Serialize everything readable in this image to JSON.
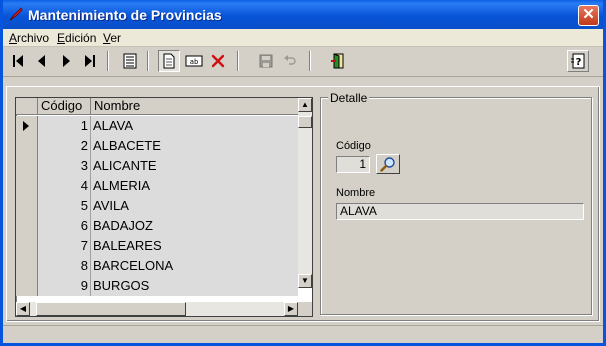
{
  "window": {
    "title": "Mantenimiento de Provincias",
    "icons": {
      "app": "quill-pen-icon",
      "close": "close-icon"
    },
    "colors": {
      "titlebar": "#0a54d8",
      "close": "#c2381a"
    }
  },
  "menu": {
    "items": [
      {
        "label": "Archivo",
        "accesskey": "A"
      },
      {
        "label": "Edición",
        "accesskey": "E"
      },
      {
        "label": "Ver",
        "accesskey": "V"
      }
    ]
  },
  "toolbar": {
    "buttons": [
      {
        "icon": "first-record-icon"
      },
      {
        "icon": "previous-record-icon"
      },
      {
        "icon": "next-record-icon"
      },
      {
        "icon": "last-record-icon"
      },
      {
        "icon": "list-view-icon"
      },
      {
        "icon": "new-record-icon"
      },
      {
        "icon": "edit-record-icon"
      },
      {
        "icon": "delete-icon"
      },
      {
        "icon": "save-icon"
      },
      {
        "icon": "undo-icon"
      },
      {
        "icon": "exit-door-icon"
      },
      {
        "icon": "help-icon"
      }
    ]
  },
  "grid": {
    "columns": [
      "Código",
      "Nombre"
    ],
    "rows": [
      {
        "codigo": "1",
        "nombre": "ALAVA"
      },
      {
        "codigo": "2",
        "nombre": "ALBACETE"
      },
      {
        "codigo": "3",
        "nombre": "ALICANTE"
      },
      {
        "codigo": "4",
        "nombre": "ALMERIA"
      },
      {
        "codigo": "5",
        "nombre": "AVILA"
      },
      {
        "codigo": "6",
        "nombre": "BADAJOZ"
      },
      {
        "codigo": "7",
        "nombre": "BALEARES"
      },
      {
        "codigo": "8",
        "nombre": "BARCELONA"
      },
      {
        "codigo": "9",
        "nombre": "BURGOS"
      }
    ],
    "selected_row": 1
  },
  "detail": {
    "group_label": "Detalle",
    "codigo_label": "Código",
    "codigo_value": "1",
    "nombre_label": "Nombre",
    "nombre_value": "ALAVA",
    "lookup_icon": "magnifier-icon"
  }
}
